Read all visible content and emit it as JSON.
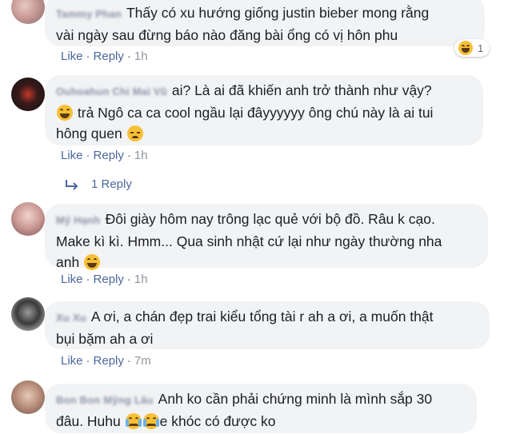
{
  "comments": [
    {
      "text": "Thấy có xu hướng giống justin bieber mong rằng vài ngày sau đừng báo nào đăng bài ổng có vị hôn phu",
      "line1": "Thấy có xu hướng giống justin bieber mong rằng",
      "line2": "vài ngày sau đừng báo nào đăng bài ổng có vị hôn phu",
      "like": "Like",
      "reply": "Reply",
      "time": "1h",
      "reaction_count": "1"
    },
    {
      "line1": "ai? Là ai đã khiến anh trở thành như vậy?",
      "line2": "trả Ngô ca ca cool ngầu lại đâyyyyyy ông chú này là ai tui",
      "line3": "hông quen",
      "like": "Like",
      "reply": "Reply",
      "time": "1h",
      "replies_label": "1 Reply"
    },
    {
      "line1": "Đôi giày hôm nay trông lạc quẻ với bộ đồ. Râu k cạo.",
      "line2": "Make kì kì. Hmm... Qua sinh nhật cứ lại như ngày thường nha",
      "line3": "anh",
      "like": "Like",
      "reply": "Reply",
      "time": "1h"
    },
    {
      "line1": "A ơi, a chán đẹp trai kiểu tổng tài r ah a ơi, a muốn thật",
      "line2": "bụi bặm ah a ơi",
      "like": "Like",
      "reply": "Reply",
      "time": "7m"
    },
    {
      "line1": "Anh ko cần phải chứng minh là mình sắp 30",
      "line2_a": "đâu. Huhu",
      "line2_b": "e khóc có được ko"
    }
  ],
  "separator": "·",
  "colors": {
    "link": "#4b67a0",
    "bubble": "#f2f3f5",
    "meta": "#90949c",
    "emoji": "#f7c035"
  }
}
